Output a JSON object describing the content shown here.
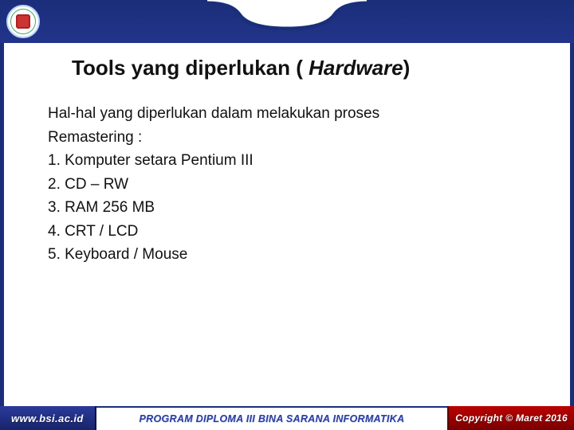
{
  "title_main": "Tools yang diperlukan ( ",
  "title_italic": "Hardware",
  "title_end": ")",
  "intro_line1": "Hal-hal yang diperlukan dalam melakukan proses",
  "intro_line2": "Remastering :",
  "items": [
    "1. Komputer setara Pentium III",
    "2. CD – RW",
    "3. RAM 256 MB",
    "4. CRT / LCD",
    "5. Keyboard / Mouse"
  ],
  "footer": {
    "url": "www.bsi.ac.id",
    "program": "PROGRAM DIPLOMA III BINA SARANA INFORMATIKA",
    "copyright": "Copyright © Maret 2016"
  }
}
